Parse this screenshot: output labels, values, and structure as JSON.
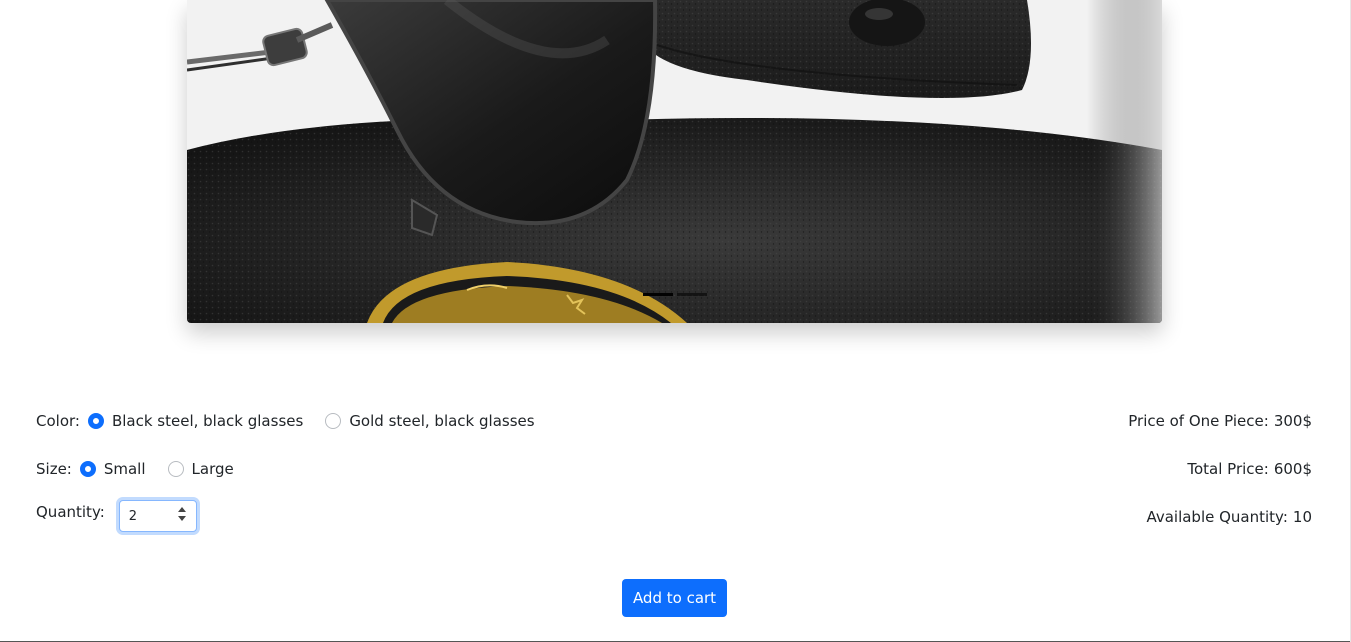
{
  "carousel": {
    "slide_count": 2,
    "active_index": 0
  },
  "options": {
    "color": {
      "label": "Color:",
      "choices": [
        {
          "label": "Black steel, black glasses",
          "checked": true
        },
        {
          "label": "Gold steel, black glasses",
          "checked": false
        }
      ]
    },
    "size": {
      "label": "Size:",
      "choices": [
        {
          "label": "Small",
          "checked": true
        },
        {
          "label": "Large",
          "checked": false
        }
      ]
    },
    "quantity": {
      "label": "Quantity:",
      "value": "2"
    }
  },
  "summary": {
    "price_label": "Price of One Piece:",
    "price_value": "300$",
    "total_label": "Total Price:",
    "total_value": "600$",
    "available_label": "Available Quantity:",
    "available_value": "10"
  },
  "actions": {
    "add_to_cart": "Add to cart"
  },
  "colors": {
    "accent": "#0d6efd",
    "text": "#212529"
  }
}
